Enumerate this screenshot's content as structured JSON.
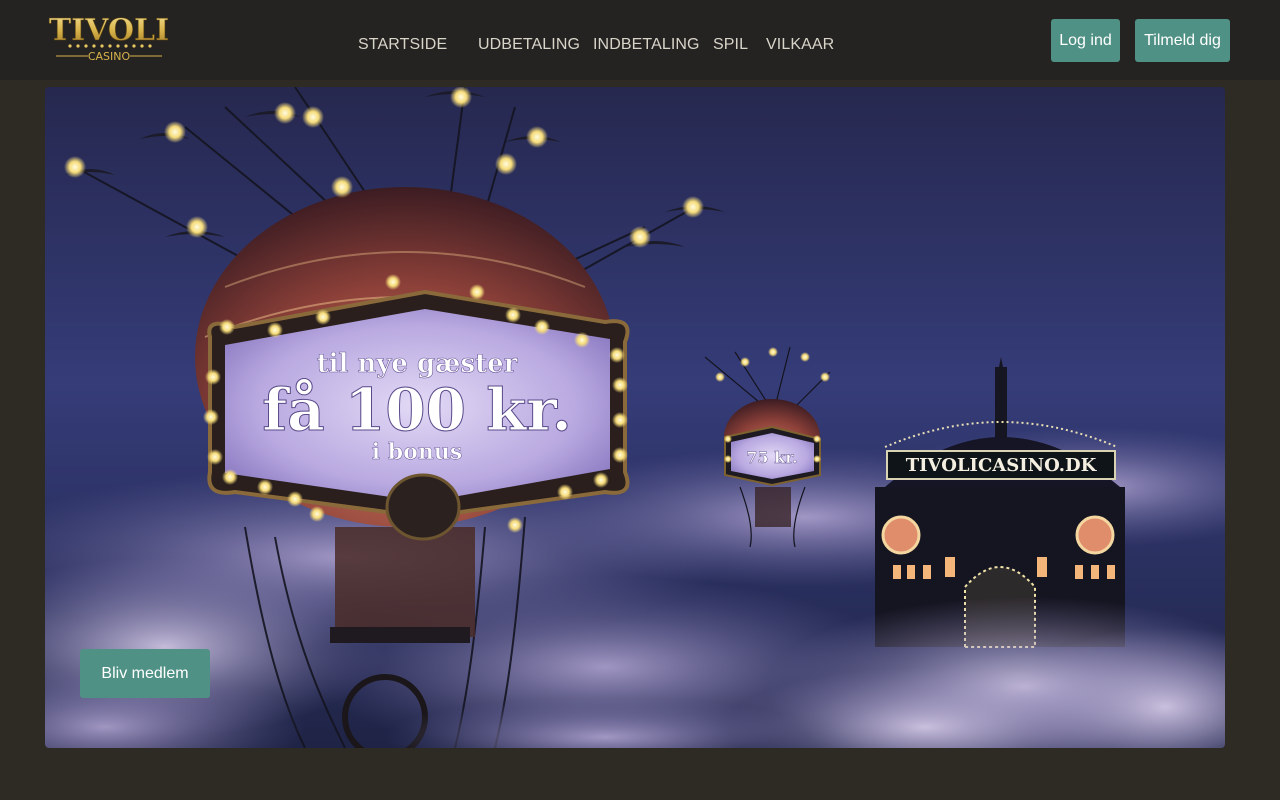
{
  "brand": {
    "logo_top": "TIVOLI",
    "logo_bottom": "CASINO"
  },
  "nav": {
    "items": [
      "STARTSIDE",
      "UDBETALING",
      "INDBETALING",
      "SPIL",
      "VILKAAR"
    ]
  },
  "auth": {
    "login_label": "Log ind",
    "signup_label": "Tilmeld dig"
  },
  "hero": {
    "sign_line1": "til nye gæster",
    "sign_line2": "få 100 kr.",
    "sign_line3": "i bonus",
    "small_balloon": "75 kr.",
    "building_sign": "TIVOLICASINO.DK",
    "cta_label": "Bliv medlem"
  },
  "colors": {
    "accent": "#4f9184",
    "topbar": "#242322",
    "background": "#2d2b24",
    "logo_gold": "#d8b34a"
  }
}
